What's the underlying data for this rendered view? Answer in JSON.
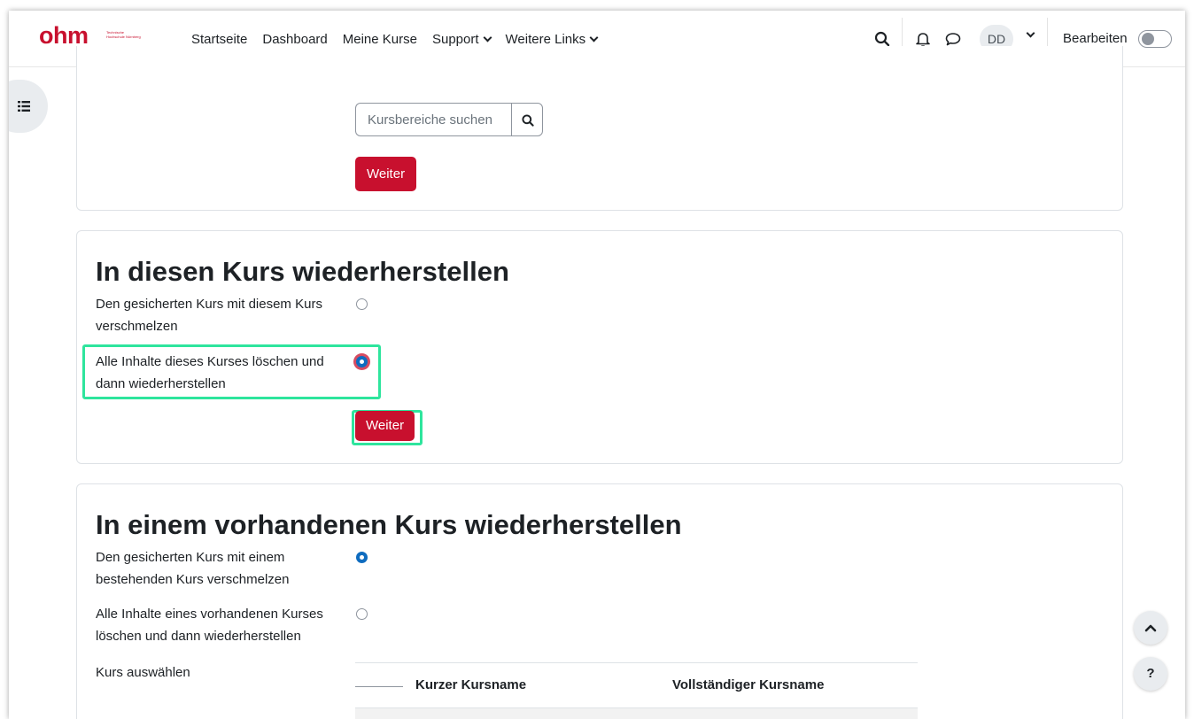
{
  "navbar": {
    "logo": {
      "wordmark": "ohm",
      "subtext": "Technische Hochschule Nürnberg"
    },
    "links": [
      {
        "label": "Startseite",
        "has_dropdown": false
      },
      {
        "label": "Dashboard",
        "has_dropdown": false
      },
      {
        "label": "Meine Kurse",
        "has_dropdown": false
      },
      {
        "label": "Support",
        "has_dropdown": true
      },
      {
        "label": "Weitere Links",
        "has_dropdown": true
      }
    ],
    "icons": [
      "search-icon",
      "bell-icon",
      "chat-icon"
    ],
    "user_initials": "DD",
    "edit_mode_label": "Bearbeiten",
    "edit_mode_on": false
  },
  "section_search": {
    "search_placeholder": "Kursbereiche suchen",
    "submit_label": "Weiter"
  },
  "section_this_course": {
    "title": "In diesen Kurs wiederherstellen",
    "options": [
      {
        "label": "Den gesicherten Kurs mit diesem Kurs verschmelzen",
        "checked": false
      },
      {
        "label": "Alle Inhalte dieses Kurses löschen und dann wiederherstellen",
        "checked": true
      }
    ],
    "submit_label": "Weiter"
  },
  "section_existing_course": {
    "title": "In einem vorhandenen Kurs wiederherstellen",
    "options": [
      {
        "label": "Den gesicherten Kurs mit einem bestehenden Kurs verschmelzen",
        "checked": true
      },
      {
        "label": "Alle Inhalte eines vorhandenen Kurses löschen und dann wiederherstellen",
        "checked": false
      }
    ],
    "select_course_label": "Kurs auswählen",
    "table_headers": [
      "Kurzer Kursname",
      "Vollständiger Kursname"
    ]
  },
  "floating": {
    "help_label": "?"
  },
  "colors": {
    "accent": "#c8102e",
    "highlight": "#2ee59d",
    "radio_checked": "#0f6cbf"
  }
}
